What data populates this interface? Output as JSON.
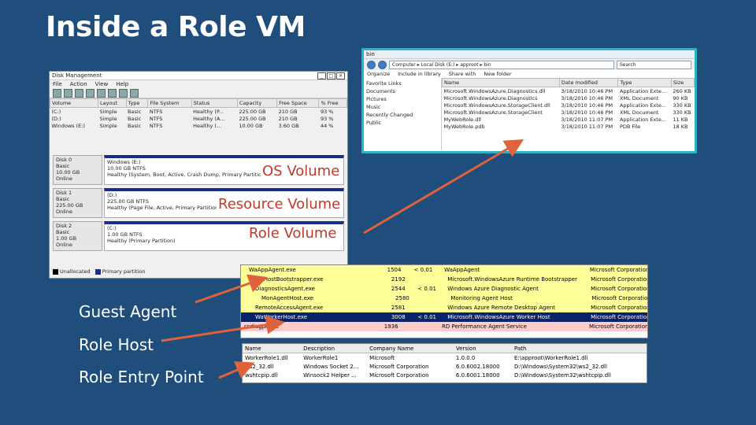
{
  "slide": {
    "title": "Inside a Role VM"
  },
  "disk_mgmt": {
    "title": "Disk Management",
    "menu": [
      "File",
      "Action",
      "View",
      "Help"
    ],
    "columns": [
      "Volume",
      "Layout",
      "Type",
      "File System",
      "Status",
      "Capacity",
      "Free Space",
      "% Free"
    ],
    "rows": [
      [
        "(C:)",
        "Simple",
        "Basic",
        "NTFS",
        "Healthy (P...",
        "225.00 GB",
        "210 GB",
        "93 %"
      ],
      [
        "(D:)",
        "Simple",
        "Basic",
        "NTFS",
        "Healthy (A...",
        "225.00 GB",
        "210 GB",
        "93 %"
      ],
      [
        "Windows (E:)",
        "Simple",
        "Basic",
        "NTFS",
        "Healthy (...",
        "10.00 GB",
        "3.60 GB",
        "44 %"
      ]
    ],
    "disks": [
      {
        "label": [
          "Disk 0",
          "Basic",
          "10.00 GB",
          "Online"
        ],
        "part": [
          "Windows (E:)",
          "10.00 GB NTFS",
          "Healthy (System, Boot, Active, Crash Dump, Primary Partition)"
        ]
      },
      {
        "label": [
          "Disk 1",
          "Basic",
          "225.00 GB",
          "Online"
        ],
        "part": [
          "(D:)",
          "225.00 GB NTFS",
          "Healthy (Page File, Active, Primary Partition)"
        ]
      },
      {
        "label": [
          "Disk 2",
          "Basic",
          "1.00 GB",
          "Online"
        ],
        "part": [
          "(C:)",
          "1.00 GB NTFS",
          "Healthy (Primary Partition)"
        ]
      }
    ],
    "legend": [
      "Unallocated",
      "Primary partition"
    ]
  },
  "explorer": {
    "title": "bin",
    "address": "Computer ▸ Local Disk (E:) ▸ approot ▸ bin",
    "search_placeholder": "Search",
    "toolbar": [
      "Organize",
      "Include in library",
      "Share with",
      "New folder"
    ],
    "nav": [
      "Favorite Links",
      "Documents",
      "Pictures",
      "Music",
      "Recently Changed",
      "Public"
    ],
    "columns": [
      "Name",
      "Date modified",
      "Type",
      "Size"
    ],
    "files": [
      [
        "Microsoft.WindowsAzure.Diagnostics.dll",
        "3/18/2010 10:46 PM",
        "Application Exte...",
        "260 KB"
      ],
      [
        "Microsoft.WindowsAzure.Diagnostics",
        "3/18/2010 10:46 PM",
        "XML Document",
        "90 KB"
      ],
      [
        "Microsoft.WindowsAzure.StorageClient.dll",
        "3/18/2010 10:46 PM",
        "Application Exte...",
        "330 KB"
      ],
      [
        "Microsoft.WindowsAzure.StorageClient",
        "3/18/2010 10:46 PM",
        "XML Document",
        "330 KB"
      ],
      [
        "MyWebRole.dll",
        "3/18/2010 11:07 PM",
        "Application Exte...",
        "11 KB"
      ],
      [
        "MyWebRole.pdb",
        "3/18/2010 11:07 PM",
        "PDB File",
        "18 KB"
      ]
    ]
  },
  "labels": {
    "os_volume": "OS Volume",
    "resource_volume": "Resource Volume",
    "role_volume": "Role Volume",
    "guest_agent": "Guest Agent",
    "role_host": "Role Host",
    "role_entry_point": "Role Entry Point"
  },
  "processes": [
    {
      "name": "WaAppAgent.exe",
      "pid": "1504",
      "cpu": "< 0.01",
      "desc": "WaAppAgent",
      "company": "Microsoft Corporation",
      "style": "yellow"
    },
    {
      "name": "WaHostBootstrapper.exe",
      "pid": "2192",
      "cpu": "",
      "desc": "Microsoft.WindowsAzure Runtime Bootstrapper",
      "company": "Microsoft Corporation",
      "style": "yellow"
    },
    {
      "name": "DiagnosticsAgent.exe",
      "pid": "2544",
      "cpu": "< 0.01",
      "desc": "Windows Azure Diagnostic Agent",
      "company": "Microsoft Corporation",
      "style": "yellow"
    },
    {
      "name": "MonAgentHost.exe",
      "pid": "2580",
      "cpu": "",
      "desc": "Monitoring Agent Host",
      "company": "Microsoft Corporation",
      "style": "yellow"
    },
    {
      "name": "RemoteAccessAgent.exe",
      "pid": "2581",
      "cpu": "",
      "desc": "Windows Azure Remote Desktop Agent",
      "company": "Microsoft Corporation",
      "style": "yellow"
    },
    {
      "name": "WaWorkerHost.exe",
      "pid": "3008",
      "cpu": "< 0.01",
      "desc": "Microsoft.WindowsAzure Worker Host",
      "company": "Microsoft Corporation",
      "style": "sel"
    },
    {
      "name": "csdiagpr.exe",
      "pid": "1936",
      "cpu": "",
      "desc": "RD Performance Agent Service",
      "company": "Microsoft Corporation",
      "style": "pink"
    }
  ],
  "dlls": {
    "columns": [
      "Name",
      "Description",
      "Company Name",
      "Version",
      "Path"
    ],
    "rows": [
      [
        "WorkerRole1.dll",
        "WorkerRole1",
        "Microsoft",
        "1.0.0.0",
        "E:\\approot\\WorkerRole1.dll"
      ],
      [
        "ws2_32.dll",
        "Windows Socket 2...",
        "Microsoft Corporation",
        "6.0.6002.18000",
        "D:\\Windows\\System32\\ws2_32.dll"
      ],
      [
        "wshtcpip.dll",
        "Winsock2 Helper ...",
        "Microsoft Corporation",
        "6.0.6001.18000",
        "D:\\Windows\\System32\\wshtcpip.dll"
      ]
    ]
  },
  "colors": {
    "background": "#1f4e7c",
    "accent_arrow": "#e0623a",
    "highlight_yellow": "#ffff99",
    "highlight_pink": "#ffcccc",
    "explorer_border": "#2bb3c0"
  }
}
